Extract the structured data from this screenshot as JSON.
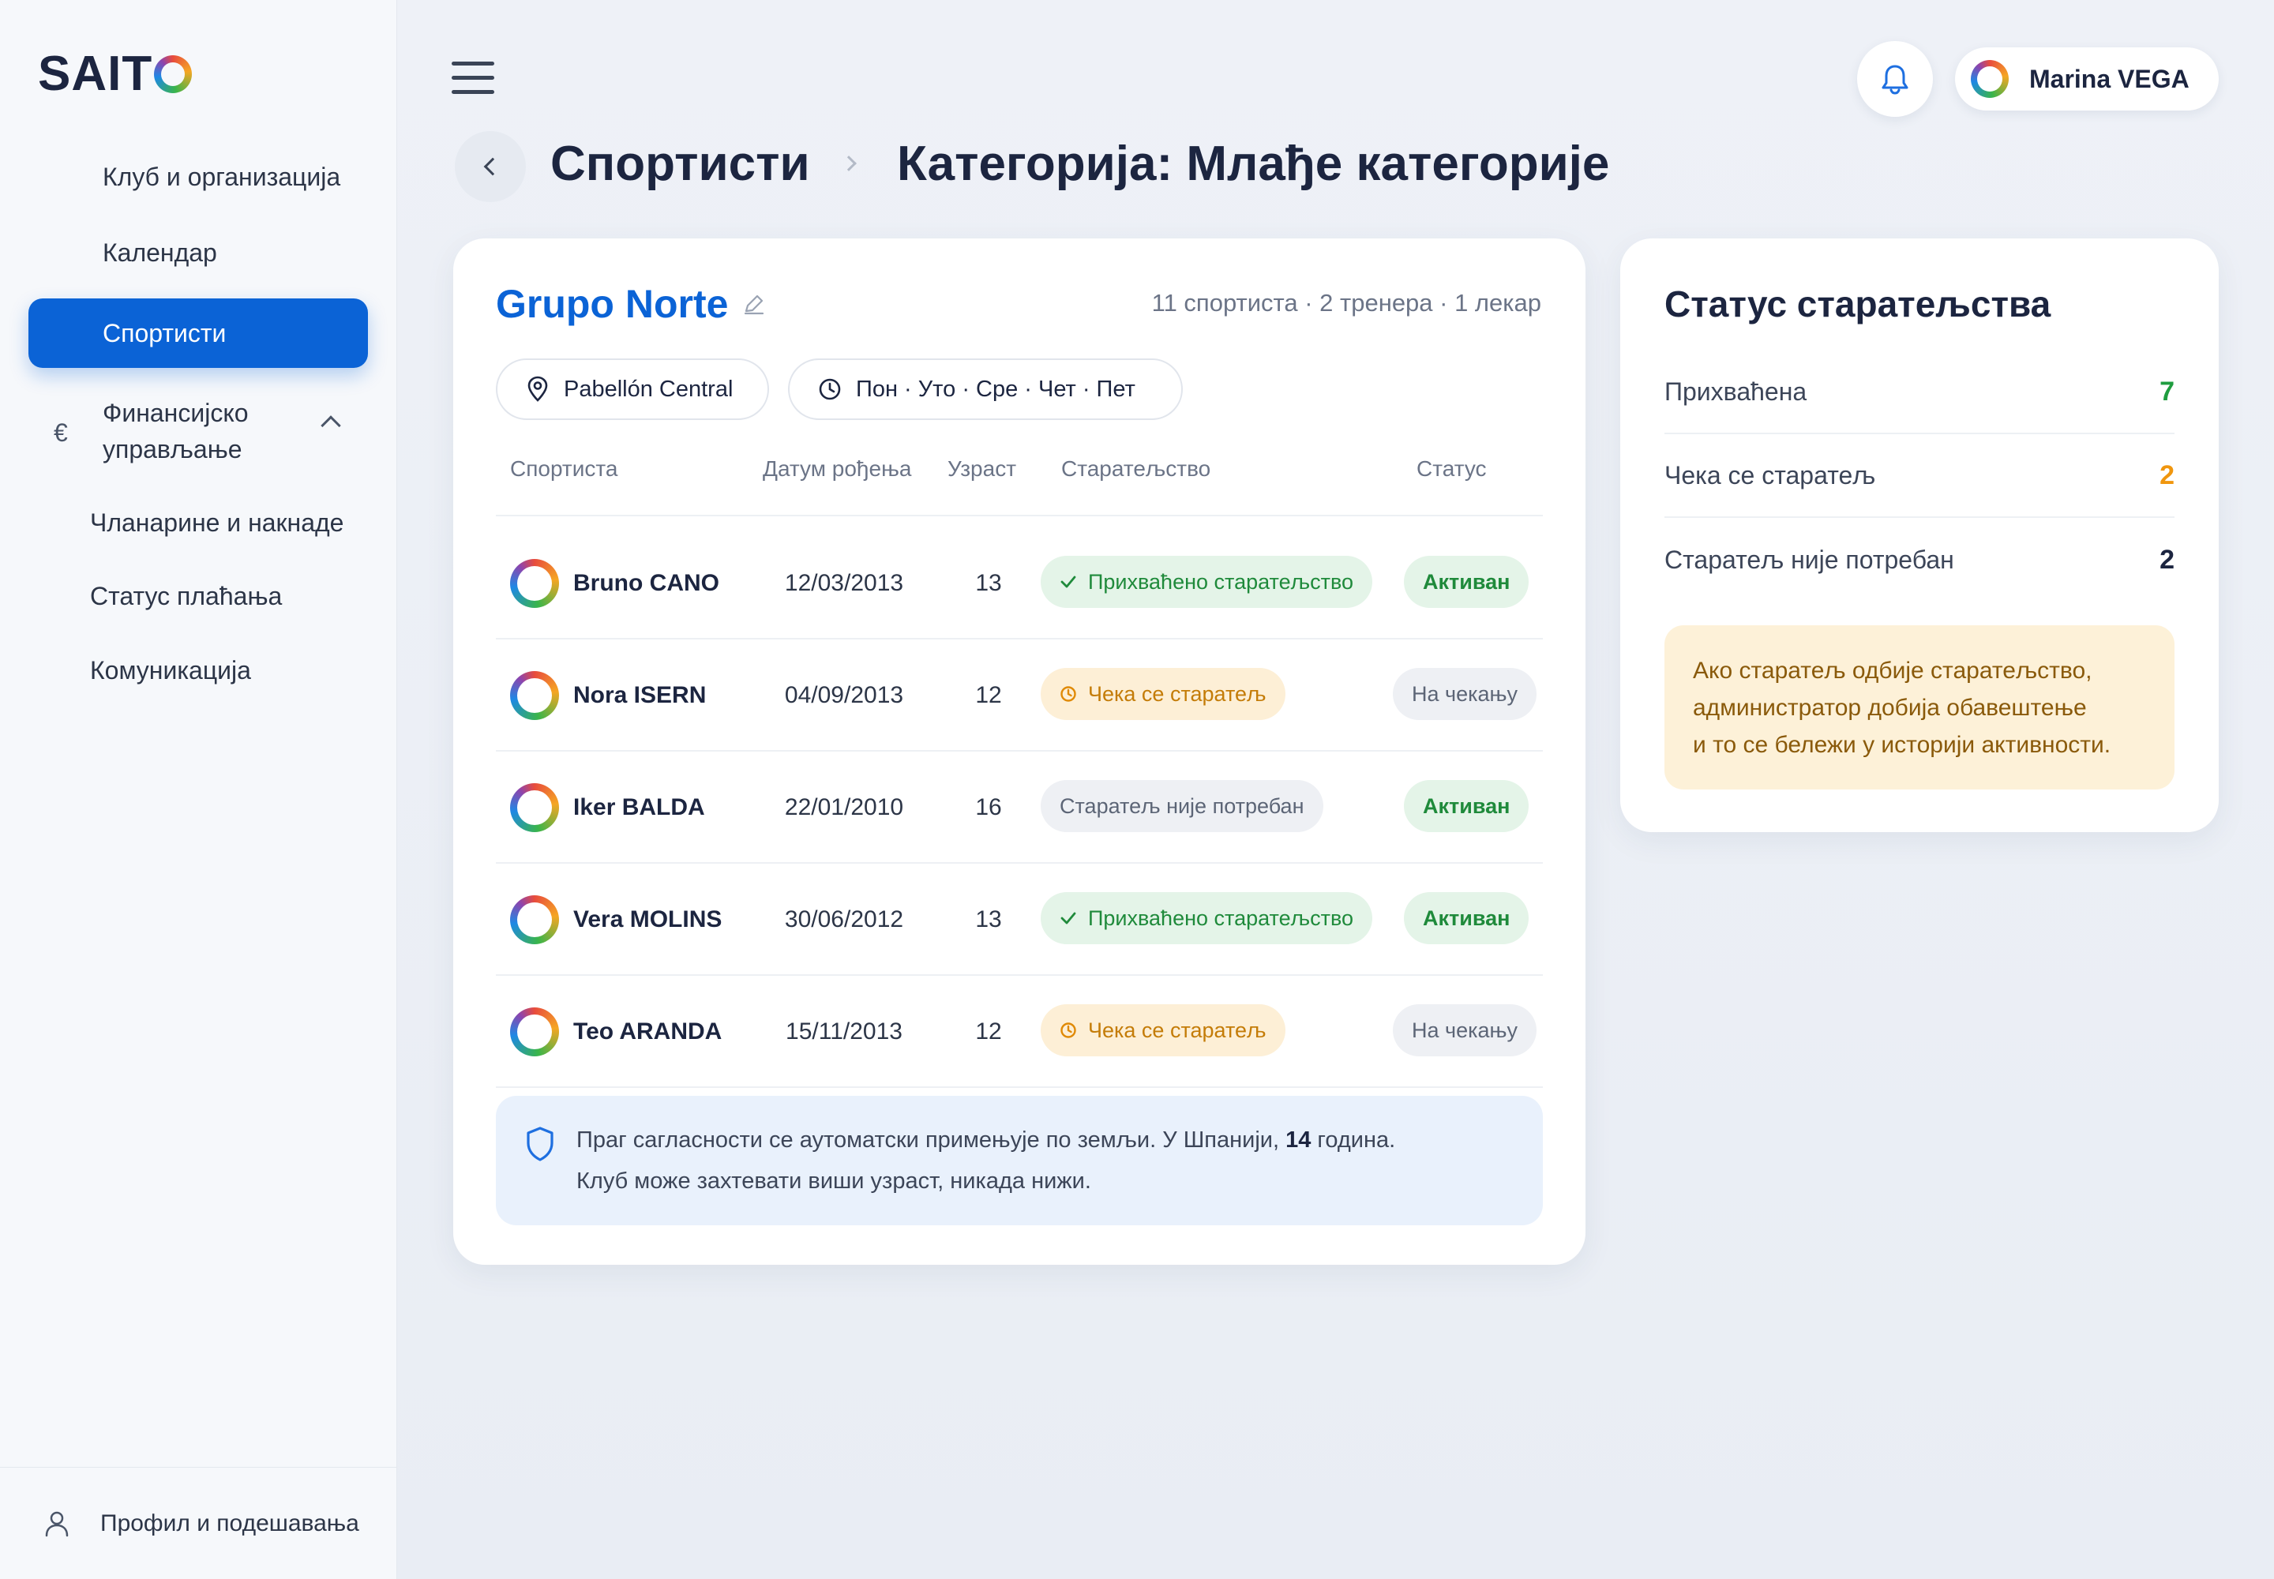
{
  "app": {
    "logo": "SAITO"
  },
  "sidebar": {
    "items": [
      {
        "label": "Клуб и организација"
      },
      {
        "label": "Календар"
      },
      {
        "label": "Спортисти"
      },
      {
        "label_line1": "Финансијско",
        "label_line2": "управљање",
        "icon": "€"
      },
      {
        "label": "Чланарине и накнаде"
      },
      {
        "label": "Статус плаћања"
      },
      {
        "label": "Комуникација"
      }
    ],
    "profile": {
      "label": "Профил и подешавања"
    }
  },
  "header": {
    "user_name": "Marina VEGA"
  },
  "breadcrumb": {
    "section": "Спортисти",
    "category": "Категорија: Млађе категорије"
  },
  "group": {
    "name": "Grupo Norte",
    "meta": "11 спортиста · 2 тренера · 1 лекар",
    "location": "Pabellón Central",
    "days": "Пон · Уто · Сре · Чет · Пет"
  },
  "table": {
    "headers": [
      "Спортиста",
      "Датум рођења",
      "Узраст",
      "Старатељство",
      "Статус"
    ],
    "rows": [
      {
        "name": "Bruno CANO",
        "dob": "12/03/2013",
        "age": "13",
        "guardian": "Прихваћено старатељство",
        "guardian_type": "accepted",
        "status": "Активан",
        "status_type": "active"
      },
      {
        "name": "Nora ISERN",
        "dob": "04/09/2013",
        "age": "12",
        "guardian": "Чека се старатељ",
        "guardian_type": "pending",
        "status": "На чекању",
        "status_type": "waiting"
      },
      {
        "name": "Iker BALDA",
        "dob": "22/01/2010",
        "age": "16",
        "guardian": "Старатељ није потребан",
        "guardian_type": "notneeded",
        "status": "Активан",
        "status_type": "active"
      },
      {
        "name": "Vera MOLINS",
        "dob": "30/06/2012",
        "age": "13",
        "guardian": "Прихваћено старатељство",
        "guardian_type": "accepted",
        "status": "Активан",
        "status_type": "active"
      },
      {
        "name": "Teo ARANDA",
        "dob": "15/11/2013",
        "age": "12",
        "guardian": "Чека се старатељ",
        "guardian_type": "pending",
        "status": "На чекању",
        "status_type": "waiting"
      }
    ]
  },
  "note": {
    "line1_pre": "Праг сагласности се аутоматски примењује по земљи. У Шпанији, ",
    "line1_bold": "14",
    "line1_post": " година.",
    "line2": "Клуб може захтевати виши узраст, никада нижи."
  },
  "guardianship": {
    "title": "Статус старатељства",
    "stats": [
      {
        "label": "Прихваћена",
        "value": "7",
        "color": "#1f9d3f"
      },
      {
        "label": "Чека се старатељ",
        "value": "2",
        "color": "#f0960e"
      },
      {
        "label": "Старатељ није потребан",
        "value": "2",
        "color": "#1c2540"
      }
    ],
    "warning_lines": [
      "Ако старатељ одбије старатељство,",
      "администратор добија обавештење",
      "и то се бележи у историји активности."
    ]
  },
  "colors": {
    "accent": "#0b63d6",
    "success": "#1f8a3b",
    "warning": "#c47c08"
  }
}
